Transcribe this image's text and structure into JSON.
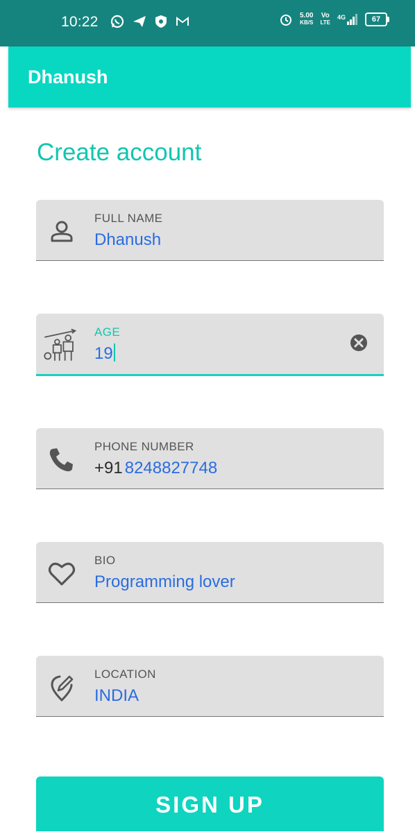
{
  "status_bar": {
    "time": "10:22",
    "net_speed_value": "5.00",
    "net_speed_unit": "KB/S",
    "volte_top": "Vo",
    "volte_bottom": "LTE",
    "network": "4G",
    "battery": "67"
  },
  "app_bar": {
    "title": "Dhanush"
  },
  "page": {
    "heading": "Create account"
  },
  "fields": [
    {
      "label": "FULL NAME",
      "value": "Dhanush",
      "icon": "person-icon"
    },
    {
      "label": "AGE",
      "value": "19",
      "icon": "age-growth-icon",
      "focused": true
    },
    {
      "label": "PHONE NUMBER",
      "prefix": "+91",
      "value": "8248827748",
      "icon": "phone-icon"
    },
    {
      "label": "BIO",
      "value": "Programming lover",
      "icon": "heart-icon"
    },
    {
      "label": "LOCATION",
      "value": "INDIA",
      "icon": "location-edit-icon"
    }
  ],
  "signup_button": {
    "label": "SIGN UP"
  },
  "colors": {
    "status_bar": "#16847e",
    "app_bar": "#08d8c2",
    "accent": "#11c6b0",
    "value_text": "#2a6ce0"
  }
}
